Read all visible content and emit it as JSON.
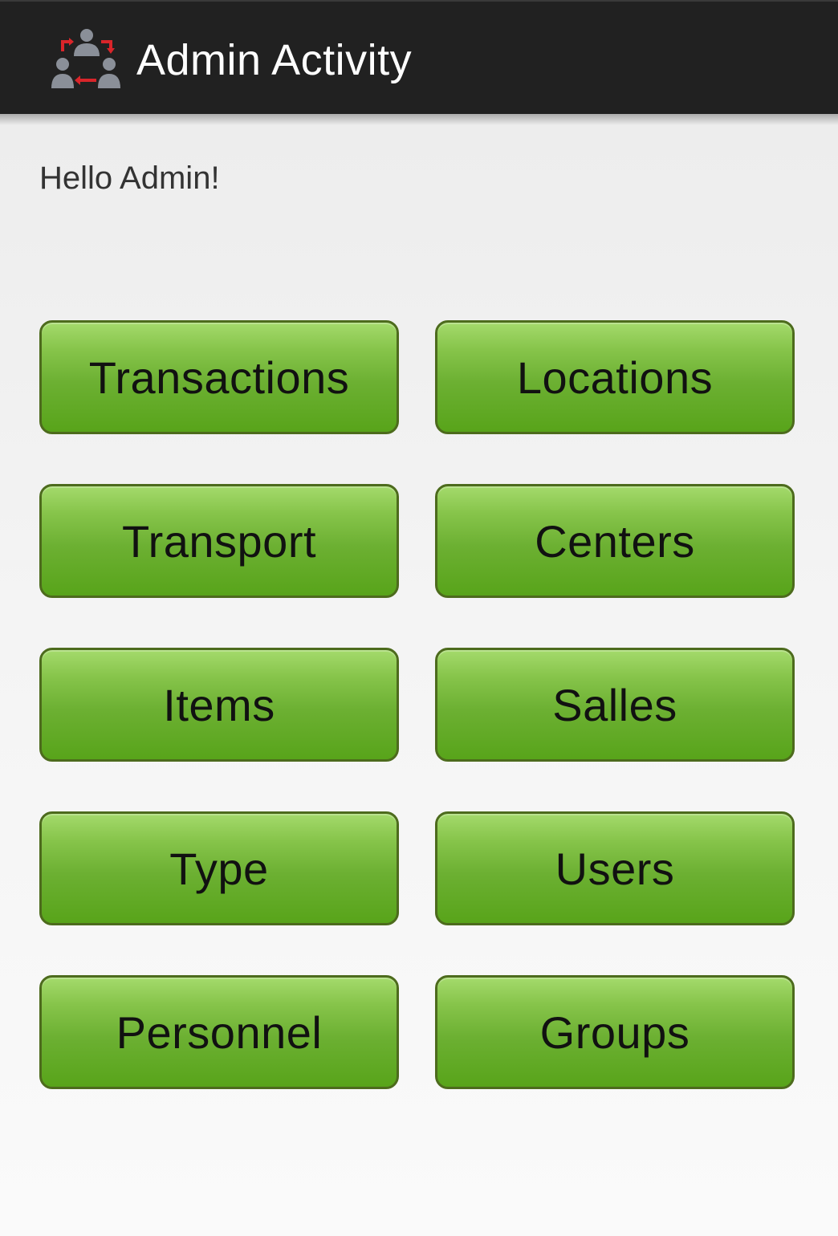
{
  "action_bar": {
    "title": "Admin Activity",
    "icon": "admin-people-exchange-icon"
  },
  "main": {
    "greeting": "Hello Admin!",
    "buttons": [
      {
        "label": "Transactions"
      },
      {
        "label": "Locations"
      },
      {
        "label": "Transport"
      },
      {
        "label": "Centers"
      },
      {
        "label": "Items"
      },
      {
        "label": "Salles"
      },
      {
        "label": "Type"
      },
      {
        "label": "Users"
      },
      {
        "label": "Personnel"
      },
      {
        "label": "Groups"
      }
    ]
  },
  "colors": {
    "action_bar_bg": "#212121",
    "button_green": "#6cb032",
    "button_border": "#4d6b1d",
    "icon_arrow_red": "#d9252a",
    "icon_person_grey": "#8a8f98"
  }
}
